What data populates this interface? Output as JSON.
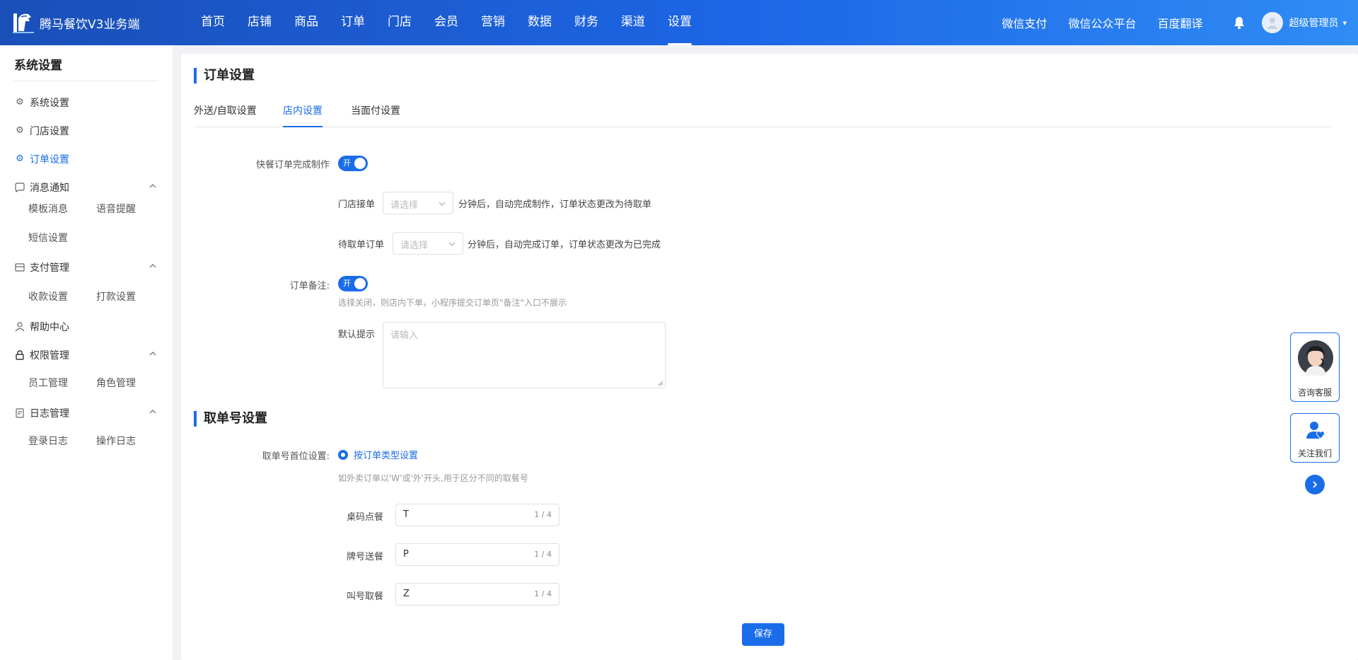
{
  "app": {
    "title": "腾马餐饮V3业务端"
  },
  "nav": {
    "items": [
      "首页",
      "店铺",
      "商品",
      "订单",
      "门店",
      "会员",
      "营销",
      "数据",
      "财务",
      "渠道",
      "设置"
    ],
    "active": "设置"
  },
  "header_links": [
    "微信支付",
    "微信公众平台",
    "百度翻译"
  ],
  "user": {
    "name": "超级管理员"
  },
  "sidebar": {
    "title": "系统设置",
    "items": [
      {
        "label": "系统设置",
        "icon": "gear-icon"
      },
      {
        "label": "门店设置",
        "icon": "gear-icon"
      },
      {
        "label": "订单设置",
        "icon": "gear-icon",
        "active": true
      },
      {
        "label": "消息通知",
        "icon": "chat-icon",
        "expanded": true,
        "children": [
          "模板消息",
          "语音提醒",
          "短信设置"
        ]
      },
      {
        "label": "支付管理",
        "icon": "wallet-icon",
        "expanded": true,
        "children": [
          "收款设置",
          "打款设置"
        ]
      },
      {
        "label": "帮助中心",
        "icon": "user-icon"
      },
      {
        "label": "权限管理",
        "icon": "lock-icon",
        "expanded": true,
        "children": [
          "员工管理",
          "角色管理"
        ]
      },
      {
        "label": "日志管理",
        "icon": "log-icon",
        "expanded": true,
        "children": [
          "登录日志",
          "操作日志"
        ]
      }
    ]
  },
  "main": {
    "section_title": "订单设置",
    "tabs": [
      "外送/自取设置",
      "店内设置",
      "当面付设置"
    ],
    "active_tab": "店内设置",
    "fast_complete": {
      "label": "快餐订单完成制作",
      "switch_text": "开",
      "store_accept_label": "门店接单",
      "store_accept_placeholder": "请选择",
      "store_accept_suffix": "分钟后，自动完成制作，订单状态更改为待取单",
      "pending_label": "待取单订单",
      "pending_placeholder": "请选择",
      "pending_suffix": "分钟后，自动完成订单，订单状态更改为已完成"
    },
    "remark": {
      "label": "订单备注:",
      "switch_text": "开",
      "hint": "选择关闭，则店内下单，小程序提交订单页\"备注\"入口不展示",
      "default_label": "默认提示",
      "placeholder": "请输入"
    },
    "pickup": {
      "section_title": "取单号设置",
      "prefix_label": "取单号首位设置:",
      "radio_label": "按订单类型设置",
      "hint": "如外卖订单以'W'或'外'开头,用于区分不同的取餐号",
      "fields": [
        {
          "label": "桌码点餐",
          "value": "T",
          "count": "1 / 4"
        },
        {
          "label": "牌号送餐",
          "value": "P",
          "count": "1 / 4"
        },
        {
          "label": "叫号取餐",
          "value": "Z",
          "count": "1 / 4"
        }
      ]
    },
    "save_label": "保存"
  },
  "float_widget": {
    "consult_label": "咨询客服",
    "follow_label": "关注我们"
  },
  "colors": {
    "primary": "#1a6de9",
    "header_start": "#1a4fb8",
    "header_end": "#2f8cf5"
  }
}
